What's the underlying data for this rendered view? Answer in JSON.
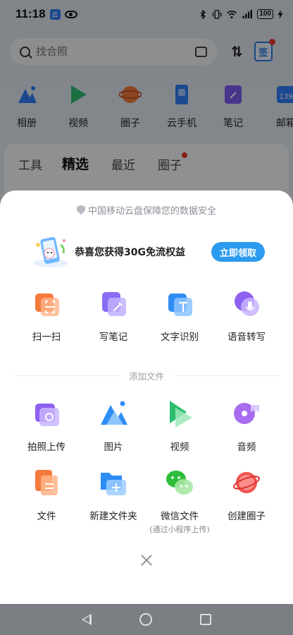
{
  "status_bar": {
    "time": "11:18",
    "app_badge": "云",
    "battery": "100"
  },
  "search": {
    "placeholder": "找合照"
  },
  "header": {
    "sort_icon": "sort-icon",
    "sign_label": "签"
  },
  "quick_apps": [
    {
      "label": "相册",
      "icon": "photo-album-icon",
      "color": "#2f7df6"
    },
    {
      "label": "视频",
      "icon": "video-play-icon",
      "color": "#2dbd6e"
    },
    {
      "label": "圈子",
      "icon": "planet-icon",
      "color": "#f07a3a"
    },
    {
      "label": "云手机",
      "icon": "cloud-phone-icon",
      "color": "#2f7df6"
    },
    {
      "label": "笔记",
      "icon": "note-icon",
      "color": "#7b5cf0"
    },
    {
      "label": "邮箱",
      "icon": "mail-icon",
      "color": "#2f7df6"
    }
  ],
  "mail_badge": "139",
  "tabs": [
    "工具",
    "精选",
    "最近",
    "圈子"
  ],
  "sheet": {
    "security_notice": "中国移动云盘保障您的数据安全",
    "promo_text": "恭喜您获得30G免流权益",
    "promo_button": "立即领取",
    "tools": [
      {
        "label": "扫一扫",
        "icon": "scan-icon",
        "color": "#f57a3c"
      },
      {
        "label": "写笔记",
        "icon": "write-note-icon",
        "color": "#8b6cf5"
      },
      {
        "label": "文字识别",
        "icon": "text-recognition-icon",
        "color": "#2e8df5"
      },
      {
        "label": "语音转写",
        "icon": "voice-transcribe-icon",
        "color": "#8d61f0"
      }
    ],
    "add_files_label": "添加文件",
    "add_files": [
      {
        "label": "拍照上传",
        "icon": "camera-upload-icon",
        "color": "#8d61f0"
      },
      {
        "label": "图片",
        "icon": "image-icon",
        "color": "#2e8df5"
      },
      {
        "label": "视频",
        "icon": "video-icon",
        "color": "#2dbd6e"
      },
      {
        "label": "音频",
        "icon": "audio-icon",
        "color": "#a86cf0"
      },
      {
        "label": "文件",
        "icon": "file-icon",
        "color": "#f57a3c"
      },
      {
        "label": "新建文件夹",
        "icon": "new-folder-icon",
        "color": "#2e8df5"
      },
      {
        "label": "微信文件",
        "sublabel": "(通过小程序上传)",
        "icon": "wechat-icon",
        "color": "#2dbd3a"
      },
      {
        "label": "创建圈子",
        "icon": "create-circle-icon",
        "color": "#f0534f"
      }
    ],
    "close_icon": "close-icon"
  },
  "nav": {
    "back": "back-icon",
    "home": "home-icon",
    "recent": "recent-apps-icon"
  }
}
